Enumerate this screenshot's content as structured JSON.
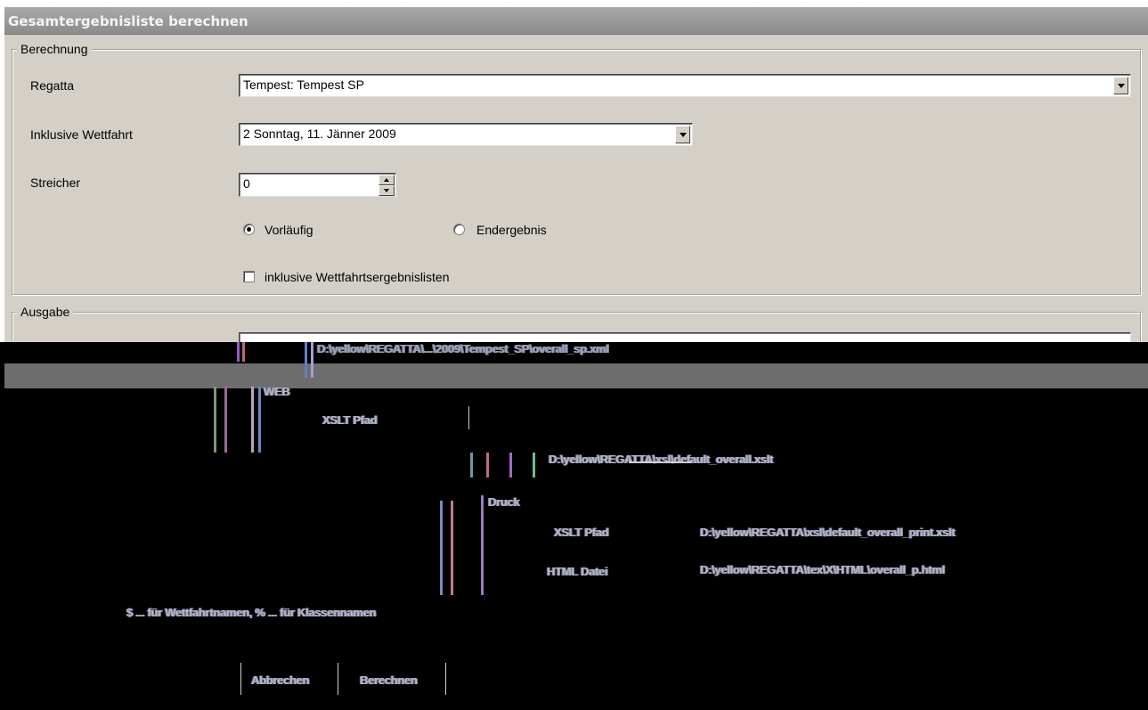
{
  "window": {
    "title": "Gesamtergebnisliste berechnen"
  },
  "berechnung": {
    "legend": "Berechnung",
    "regatta_label": "Regatta",
    "regatta_value": "Tempest:  Tempest SP",
    "wettfahrt_label": "Inklusive Wettfahrt",
    "wettfahrt_value": "2  Sonntag, 11. Jänner 2009",
    "streicher_label": "Streicher",
    "streicher_value": "0",
    "radio_vorlaeufig": "Vorläufig",
    "radio_endergebnis": "Endergebnis",
    "checkbox_label": "inklusive Wettfahrtsergebnislisten"
  },
  "ausgabe": {
    "legend": "Ausgabe",
    "path_value": "D:\\yellow\\REGATTA\\...\\2009\\Tempest_SP\\overall_sp.xml",
    "web_label": "WEB",
    "web_xslt_label": "XSLT Pfad",
    "web_xslt_value": "D:\\yellow\\REGATTA\\xsl\\default_overall.xslt",
    "druck_label": "Druck",
    "druck_xslt_label": "XSLT Pfad",
    "druck_xslt_value": "D:\\yellow\\REGATTA\\xsl\\default_overall_print.xslt",
    "druck_html_label": "HTML Datei",
    "druck_html_value": "D:\\yellow\\REGATTA\\tex\\X\\HTML\\overall_p.html",
    "hint": "$ ... für Wettfahrtnamen, % ... für Klassennamen"
  },
  "buttons": {
    "abbrechen": "Abbrechen",
    "berechnen": "Berechnen"
  },
  "colors": {
    "dialog_bg": "#d4d0c8",
    "title_bar": "#9a9a9a",
    "corrupt_bg": "#000000"
  }
}
